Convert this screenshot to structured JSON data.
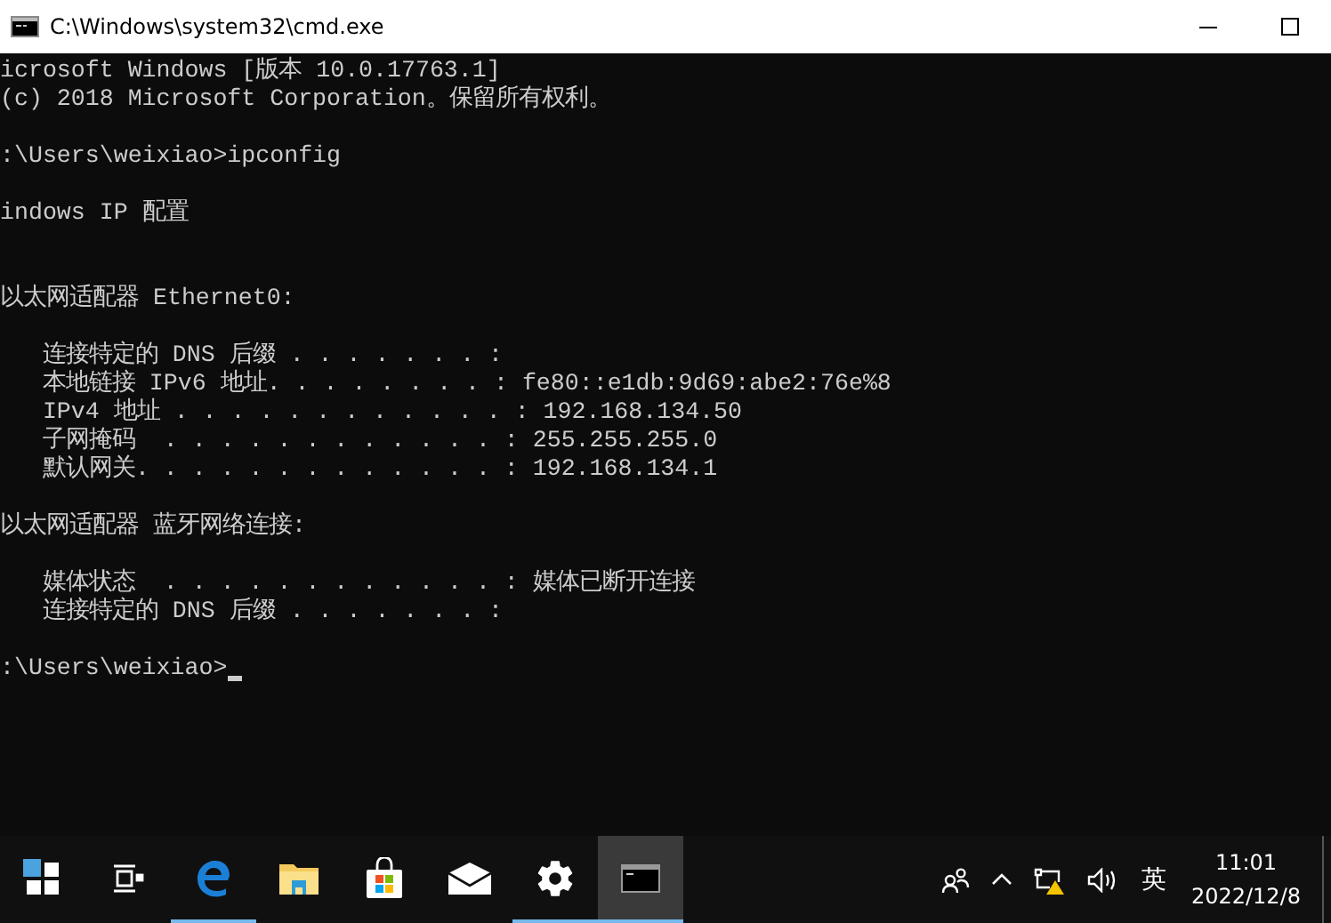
{
  "window": {
    "title": "C:\\Windows\\system32\\cmd.exe"
  },
  "console": {
    "lines": [
      {
        "kind": "text",
        "text": "icrosoft Windows [版本 10.0.17763.1]"
      },
      {
        "kind": "text",
        "text": "(c) 2018 Microsoft Corporation。保留所有权利。"
      },
      {
        "kind": "blank"
      },
      {
        "kind": "text",
        "text": ":\\Users\\weixiao>ipconfig"
      },
      {
        "kind": "blank"
      },
      {
        "kind": "text",
        "text": "indows IP 配置"
      },
      {
        "kind": "blank"
      },
      {
        "kind": "blank"
      },
      {
        "kind": "text",
        "text": "以太网适配器 Ethernet0:"
      },
      {
        "kind": "blank"
      },
      {
        "kind": "text",
        "text": "   连接特定的 DNS 后缀 . . . . . . . :"
      },
      {
        "kind": "text",
        "text": "   本地链接 IPv6 地址. . . . . . . . : fe80::e1db:9d69:abe2:76e%8"
      },
      {
        "kind": "text",
        "text": "   IPv4 地址 . . . . . . . . . . . . : 192.168.134.50"
      },
      {
        "kind": "text",
        "text": "   子网掩码  . . . . . . . . . . . . : 255.255.255.0"
      },
      {
        "kind": "text",
        "text": "   默认网关. . . . . . . . . . . . . : 192.168.134.1"
      },
      {
        "kind": "blank"
      },
      {
        "kind": "text",
        "text": "以太网适配器 蓝牙网络连接:"
      },
      {
        "kind": "blank"
      },
      {
        "kind": "text",
        "text": "   媒体状态  . . . . . . . . . . . . : 媒体已断开连接"
      },
      {
        "kind": "text",
        "text": "   连接特定的 DNS 后缀 . . . . . . . :"
      },
      {
        "kind": "blank"
      },
      {
        "kind": "text",
        "text": ":\\Users\\weixiao>",
        "cursor": true
      }
    ]
  },
  "taskbar": {
    "apps": [
      {
        "kind": "start",
        "running": false,
        "selected": false
      },
      {
        "kind": "taskview",
        "running": false,
        "selected": false
      },
      {
        "kind": "edge",
        "running": true,
        "selected": false
      },
      {
        "kind": "folder",
        "running": false,
        "selected": false
      },
      {
        "kind": "store",
        "running": false,
        "selected": false
      },
      {
        "kind": "mail",
        "running": false,
        "selected": false
      },
      {
        "kind": "settings",
        "running": true,
        "selected": false
      },
      {
        "kind": "terminal",
        "running": true,
        "selected": true
      }
    ],
    "tray": {
      "language": "英",
      "time": "11:01",
      "date": "2022/12/8"
    }
  }
}
